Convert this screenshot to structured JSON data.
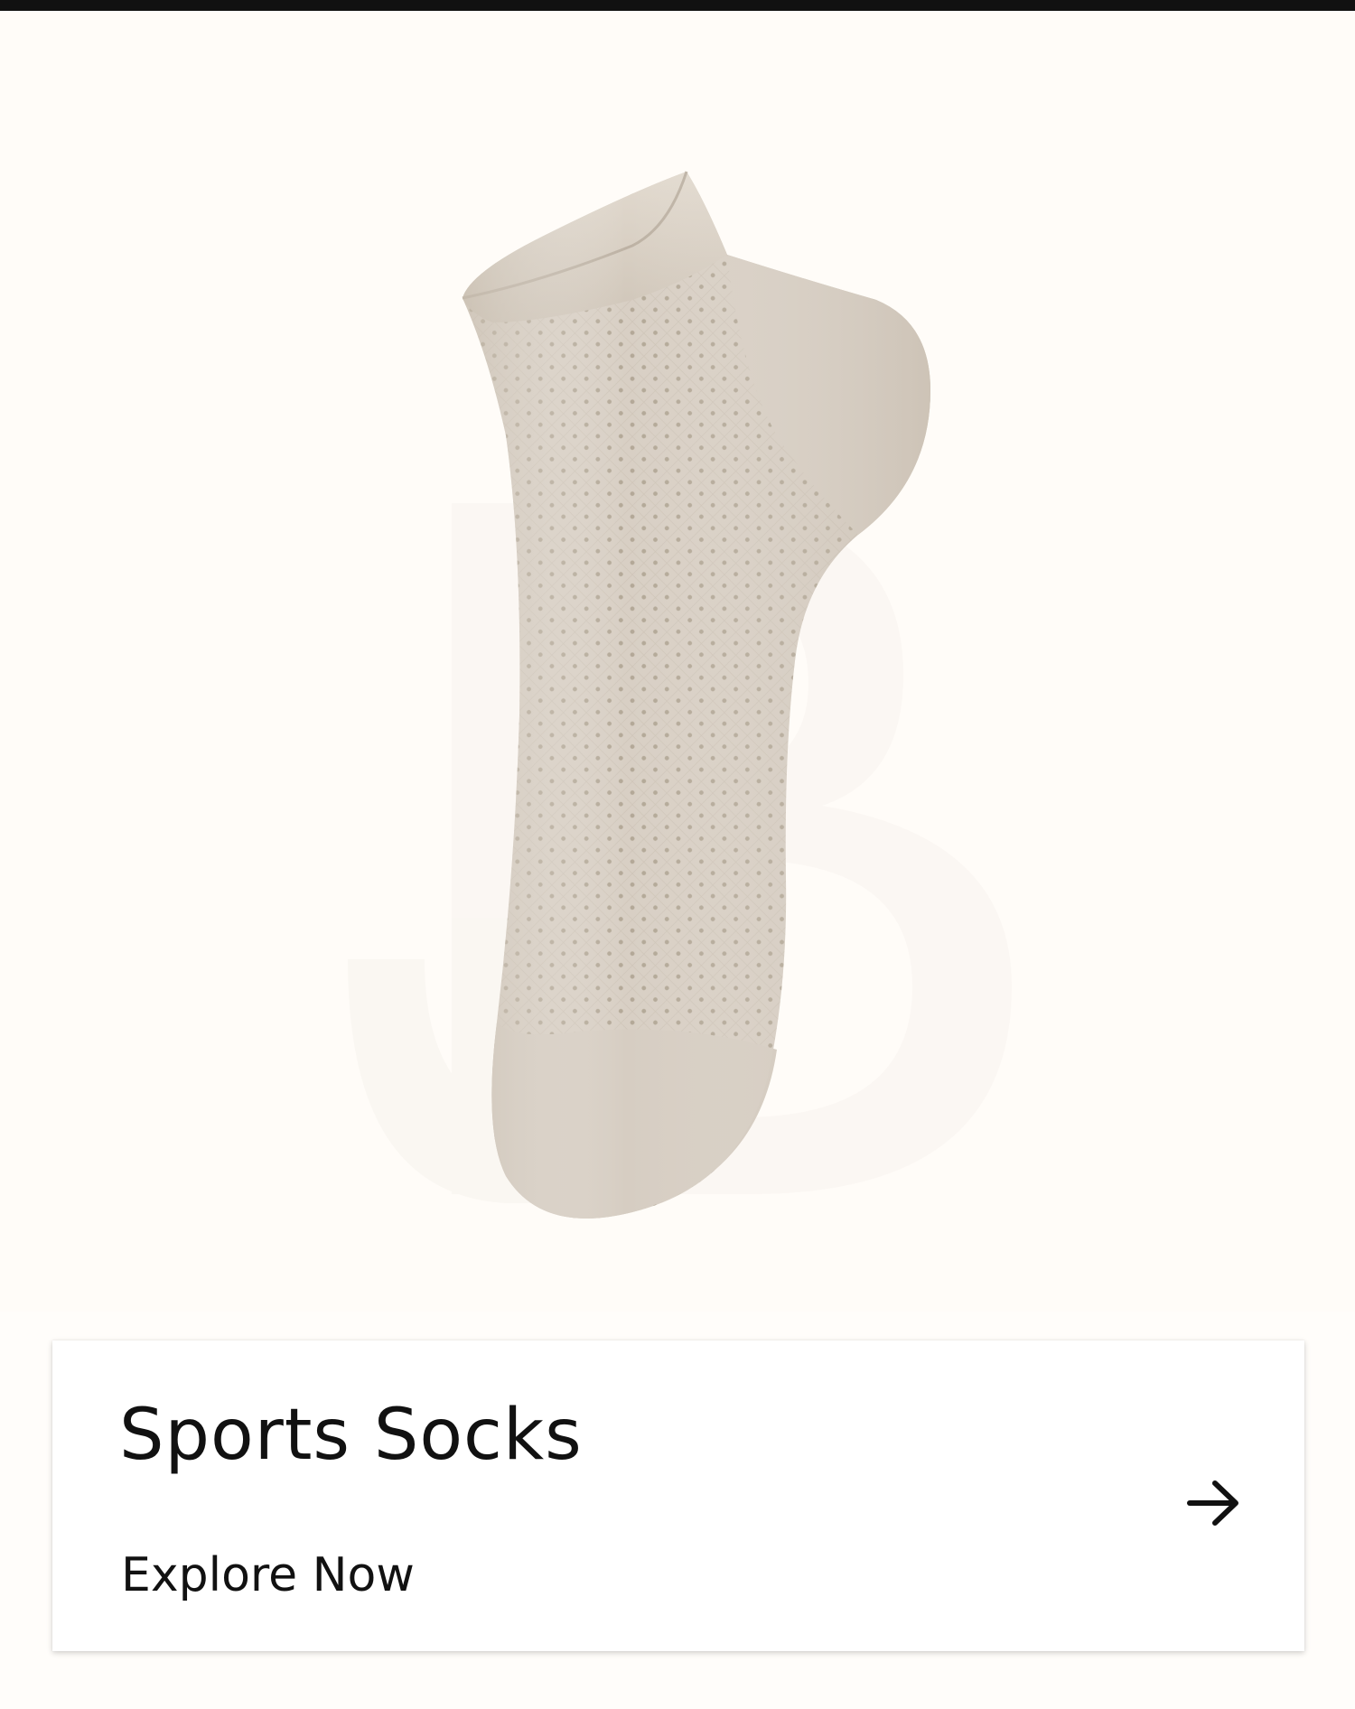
{
  "colors": {
    "background": "#fffcf8",
    "sock": "#d6cdc2",
    "text": "#111111",
    "card": "#ffffff"
  },
  "hero": {
    "image_subject": "sock",
    "watermark_letter": "B"
  },
  "card": {
    "title": "Sports Socks",
    "cta_label": "Explore Now",
    "arrow_icon": "arrow-right-icon"
  }
}
